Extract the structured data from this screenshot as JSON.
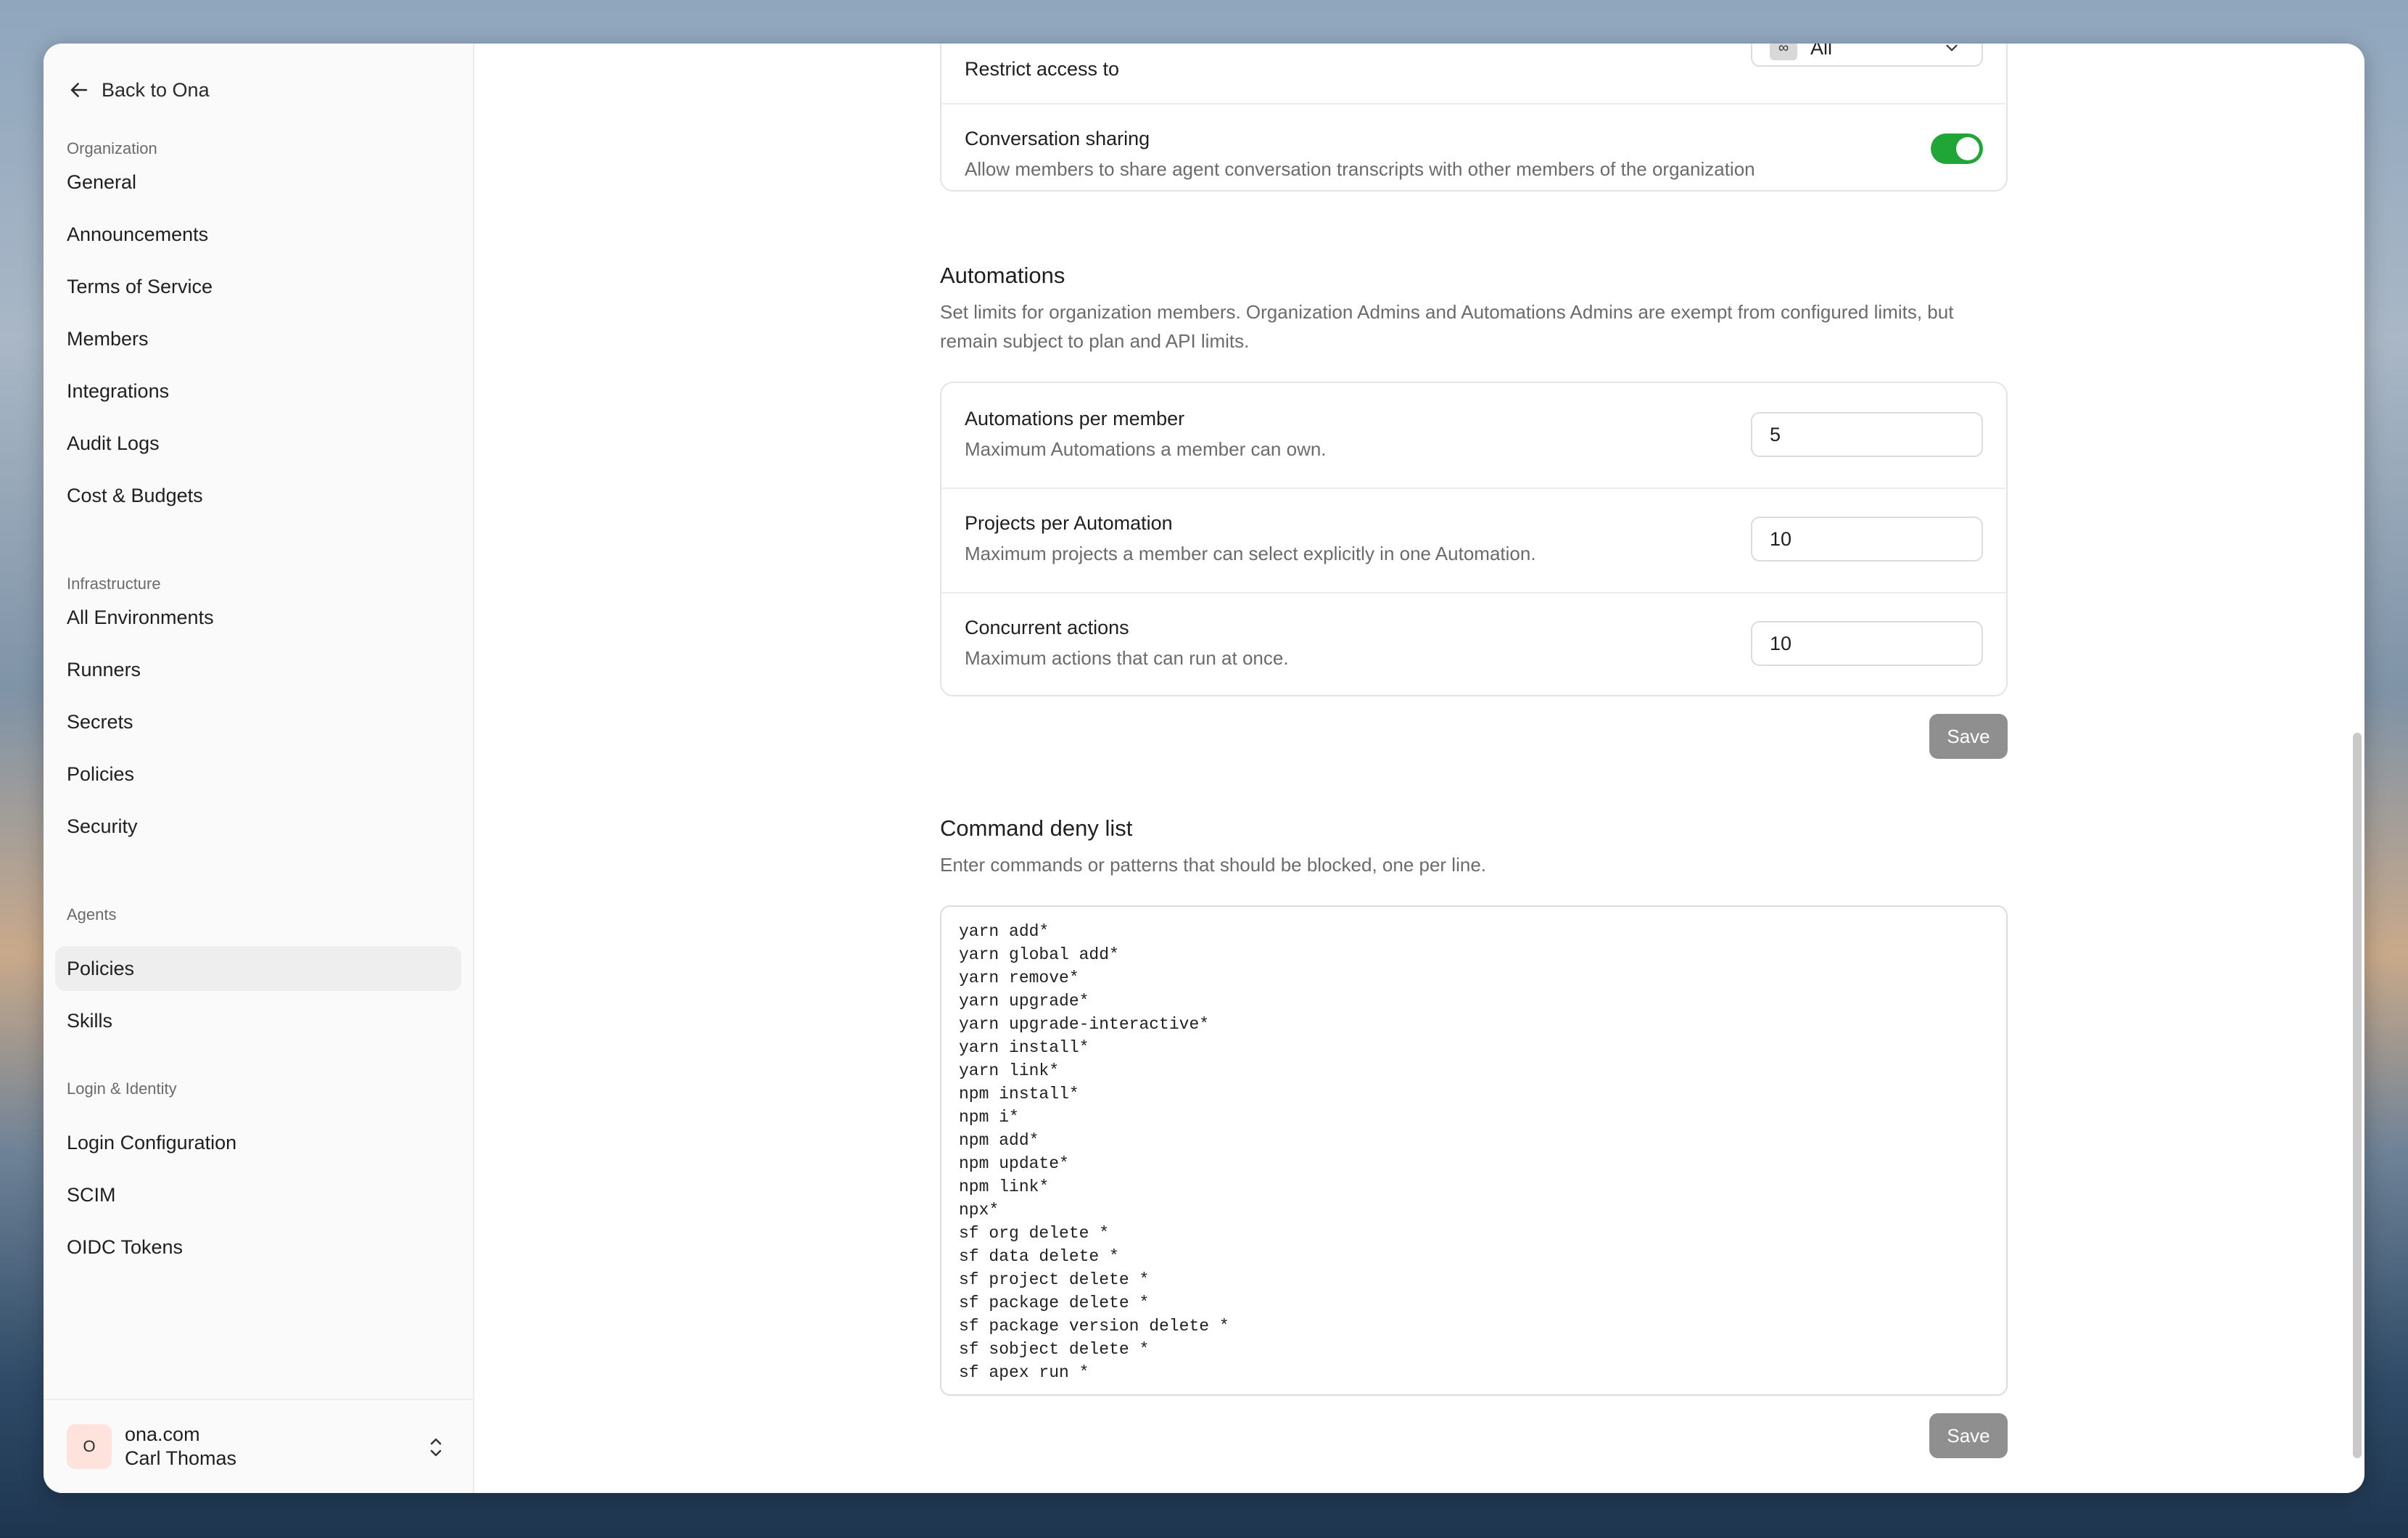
{
  "sidebar": {
    "back_label": "Back to Ona",
    "sections": {
      "organization": "Organization",
      "infrastructure": "Infrastructure",
      "agents": "Agents",
      "login_identity": "Login & Identity"
    },
    "items": {
      "general": "General",
      "announcements": "Announcements",
      "terms": "Terms of Service",
      "members": "Members",
      "integrations": "Integrations",
      "audit_logs": "Audit Logs",
      "cost_budgets": "Cost & Budgets",
      "all_environments": "All Environments",
      "runners": "Runners",
      "secrets": "Secrets",
      "policies_infra": "Policies",
      "security": "Security",
      "policies_agents": "Policies",
      "skills": "Skills",
      "login_configuration": "Login Configuration",
      "scim": "SCIM",
      "oidc_tokens": "OIDC Tokens"
    },
    "footer": {
      "avatar_letter": "O",
      "org": "ona.com",
      "user": "Carl Thomas"
    }
  },
  "sharing": {
    "restrict_title": "Restrict access to",
    "restrict_badge": "∞",
    "restrict_value": "All",
    "conversation_title": "Conversation sharing",
    "conversation_desc": "Allow members to share agent conversation transcripts with other members of the organization",
    "conversation_enabled": true
  },
  "automations": {
    "title": "Automations",
    "desc": "Set limits for organization members. Organization Admins and Automations Admins are exempt from configured limits, but remain subject to plan and API limits.",
    "per_member_title": "Automations per member",
    "per_member_desc": "Maximum Automations a member can own.",
    "per_member_value": "5",
    "projects_title": "Projects per Automation",
    "projects_desc": "Maximum projects a member can select explicitly in one Automation.",
    "projects_value": "10",
    "concurrent_title": "Concurrent actions",
    "concurrent_desc": "Maximum actions that can run at once.",
    "concurrent_value": "10",
    "save_label": "Save"
  },
  "deny_list": {
    "title": "Command deny list",
    "desc": "Enter commands or patterns that should be blocked, one per line.",
    "value": "yarn add*\nyarn global add*\nyarn remove*\nyarn upgrade*\nyarn upgrade-interactive*\nyarn install*\nyarn link*\nnpm install*\nnpm i*\nnpm add*\nnpm update*\nnpm link*\nnpx*\nsf org delete *\nsf data delete *\nsf project delete *\nsf package delete *\nsf package version delete *\nsf sobject delete *\nsf apex run *",
    "save_label": "Save"
  },
  "colors": {
    "toggle_on": "#1fa637",
    "save_button": "#8f8f8f",
    "active_nav": "#eeeeee",
    "avatar_bg": "#fde3dc"
  }
}
